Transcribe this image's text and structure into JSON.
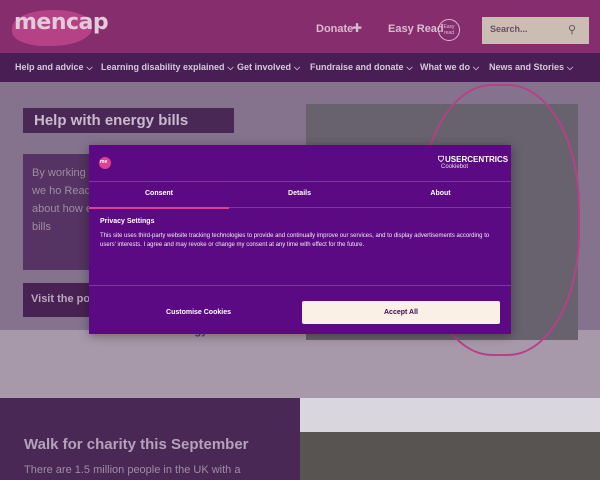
{
  "header": {
    "logo_text": "mencap",
    "donate_label": "Donate",
    "easy_read_label": "Easy Read",
    "easy_read_badge": "Easy read",
    "search": {
      "placeholder": "Search..."
    }
  },
  "nav": {
    "items": [
      {
        "label": "Help and advice"
      },
      {
        "label": "Learning disability explained"
      },
      {
        "label": "Get involved"
      },
      {
        "label": "Fundraise and donate"
      },
      {
        "label": "What we do"
      },
      {
        "label": "News and Stories"
      }
    ]
  },
  "hero": {
    "heading": "Help with energy bills",
    "intro_text": "By working Trust we ho Read advic about how energy bills",
    "visit_link": "Visit the po",
    "partner_text": "Energy Trust"
  },
  "promo": {
    "title": "Walk for charity this September",
    "text": "There are 1.5 million people in the UK with a"
  },
  "consent": {
    "logo_mark": "me",
    "brand": "USERCENTRICS",
    "brand_sub": "Cookiebot",
    "tabs": [
      {
        "label": "Consent",
        "active": true
      },
      {
        "label": "Details",
        "active": false
      },
      {
        "label": "About",
        "active": false
      }
    ],
    "section_title": "Privacy Settings",
    "section_text": "This site uses third-party website tracking technologies to provide and continually improve our services, and to display advertisements according to users' interests. I agree and may revoke or change my consent at any time with effect for the future.",
    "customise_label": "Customise Cookies",
    "accept_label": "Accept All"
  },
  "colors": {
    "brand_pink": "#e0418e",
    "dialog_purple": "#5b0a83",
    "nav_purple": "#4c1f58",
    "accept_button": "#faf0e6"
  }
}
